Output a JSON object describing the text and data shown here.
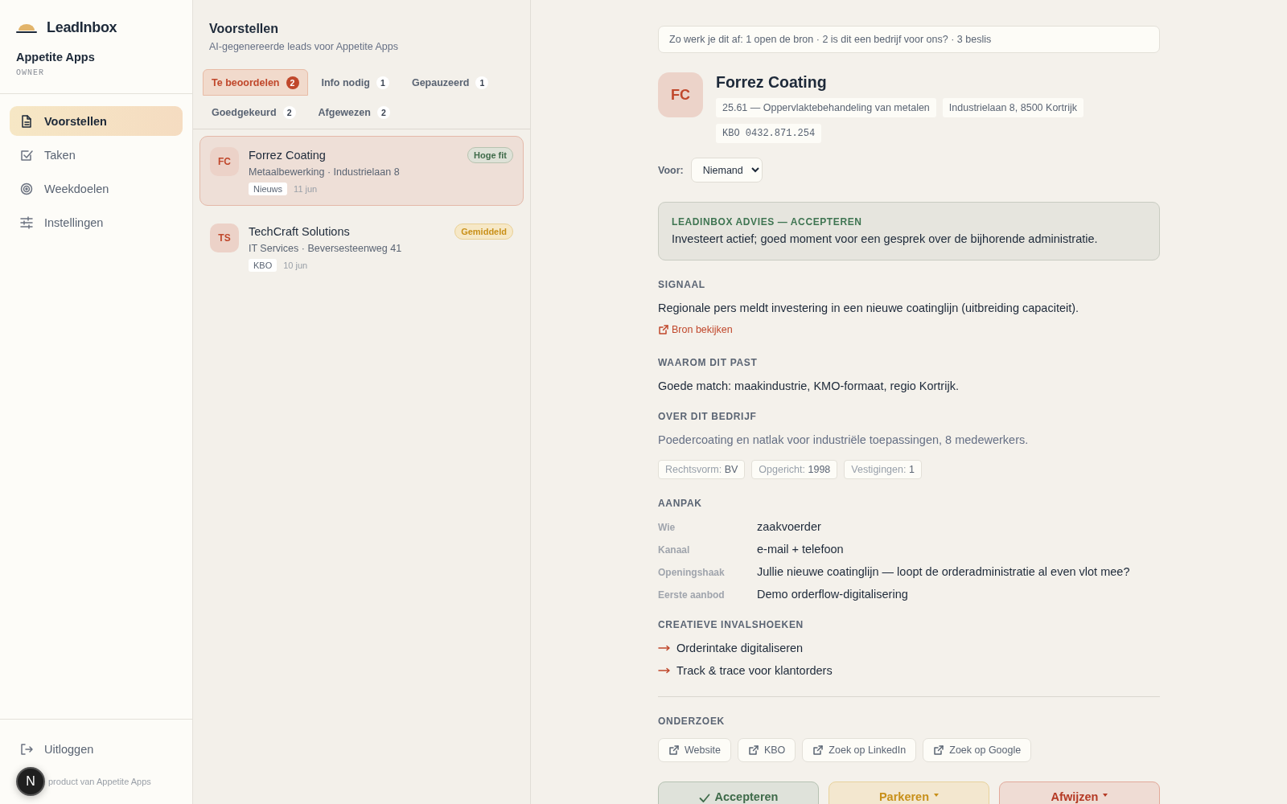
{
  "sidebar": {
    "brand": "LeadInbox",
    "org": "Appetite Apps",
    "role": "OWNER",
    "nav": [
      {
        "label": "Voorstellen",
        "selected": true
      },
      {
        "label": "Taken",
        "selected": false
      },
      {
        "label": "Weekdoelen",
        "selected": false
      },
      {
        "label": "Instellingen",
        "selected": false
      }
    ],
    "logout": "Uitloggen",
    "footer": "product van Appetite Apps"
  },
  "dev_badge": "N",
  "list": {
    "title": "Voorstellen",
    "subtitle": "AI-gegenereerde leads voor Appetite Apps",
    "tabs": [
      {
        "label": "Te beoordelen",
        "count": "2",
        "selected": true
      },
      {
        "label": "Info nodig",
        "count": "1",
        "selected": false
      },
      {
        "label": "Gepauzeerd",
        "count": "1",
        "selected": false
      },
      {
        "label": "Goedgekeurd",
        "count": "2",
        "selected": false
      },
      {
        "label": "Afgewezen",
        "count": "2",
        "selected": false
      }
    ],
    "leads": [
      {
        "initials": "FC",
        "name": "Forrez Coating",
        "meta": "Metaalbewerking · Industrielaan 8",
        "source": "Nieuws",
        "date": "11 jun",
        "fit": "Hoge fit",
        "kind": "high",
        "selected": true
      },
      {
        "initials": "TS",
        "name": "TechCraft Solutions",
        "meta": "IT Services · Beversesteenweg 41",
        "source": "KBO",
        "date": "10 jun",
        "fit": "Gemiddeld",
        "kind": "medium",
        "selected": false
      }
    ]
  },
  "detail": {
    "hint": "Zo werk je dit af: 1 open de bron · 2 is dit een bedrijf voor ons? · 3 beslis",
    "initials": "FC",
    "name": "Forrez Coating",
    "chips": [
      {
        "text": "25.61 — Oppervlaktebehandeling van metalen",
        "kind": "plain"
      },
      {
        "text": "Industrielaan 8, 8500 Kortrijk",
        "kind": "plain"
      },
      {
        "text": "KBO 0432.871.254",
        "kind": "mono"
      }
    ],
    "assign": {
      "label": "Voor:",
      "value": "Niemand"
    },
    "advice": {
      "title": "LEADINBOX ADVIES — ACCEPTEREN",
      "text": "Investeert actief; goed moment voor een gesprek over de bijhorende administratie."
    },
    "signal": {
      "heading": "SIGNAAL",
      "text": "Regionale pers meldt investering in een nieuwe coatinglijn (uitbreiding capaciteit).",
      "link": "Bron bekijken"
    },
    "fit": {
      "heading": "WAAROM DIT PAST",
      "text": "Goede match: maakindustrie, KMO-formaat, regio Kortrijk."
    },
    "about": {
      "heading": "OVER DIT BEDRIJF",
      "text": "Poedercoating en natlak voor industriële toepassingen, 8 medewerkers.",
      "facts": [
        {
          "label": "Rechtsvorm:",
          "value": "BV"
        },
        {
          "label": "Opgericht:",
          "value": "1998"
        },
        {
          "label": "Vestigingen:",
          "value": "1"
        }
      ]
    },
    "approach": {
      "heading": "AANPAK",
      "rows": [
        {
          "label": "Wie",
          "value": "zaakvoerder"
        },
        {
          "label": "Kanaal",
          "value": "e-mail + telefoon"
        },
        {
          "label": "Openingshaak",
          "value": "Jullie nieuwe coatinglijn — loopt de orderadministratie al even vlot mee?"
        },
        {
          "label": "Eerste aanbod",
          "value": "Demo orderflow-digitalisering"
        }
      ]
    },
    "angles": {
      "heading": "CREATIEVE INVALSHOEKEN",
      "items": [
        "Orderintake digitaliseren",
        "Track & trace voor klantorders"
      ]
    },
    "research": {
      "heading": "ONDERZOEK",
      "links": [
        "Website",
        "KBO",
        "Zoek op LinkedIn",
        "Zoek op Google"
      ]
    },
    "actions": [
      {
        "label": "Accepteren",
        "kind": "accept"
      },
      {
        "label": "Parkeren",
        "kind": "park"
      },
      {
        "label": "Afwijzen",
        "kind": "reject"
      }
    ]
  }
}
